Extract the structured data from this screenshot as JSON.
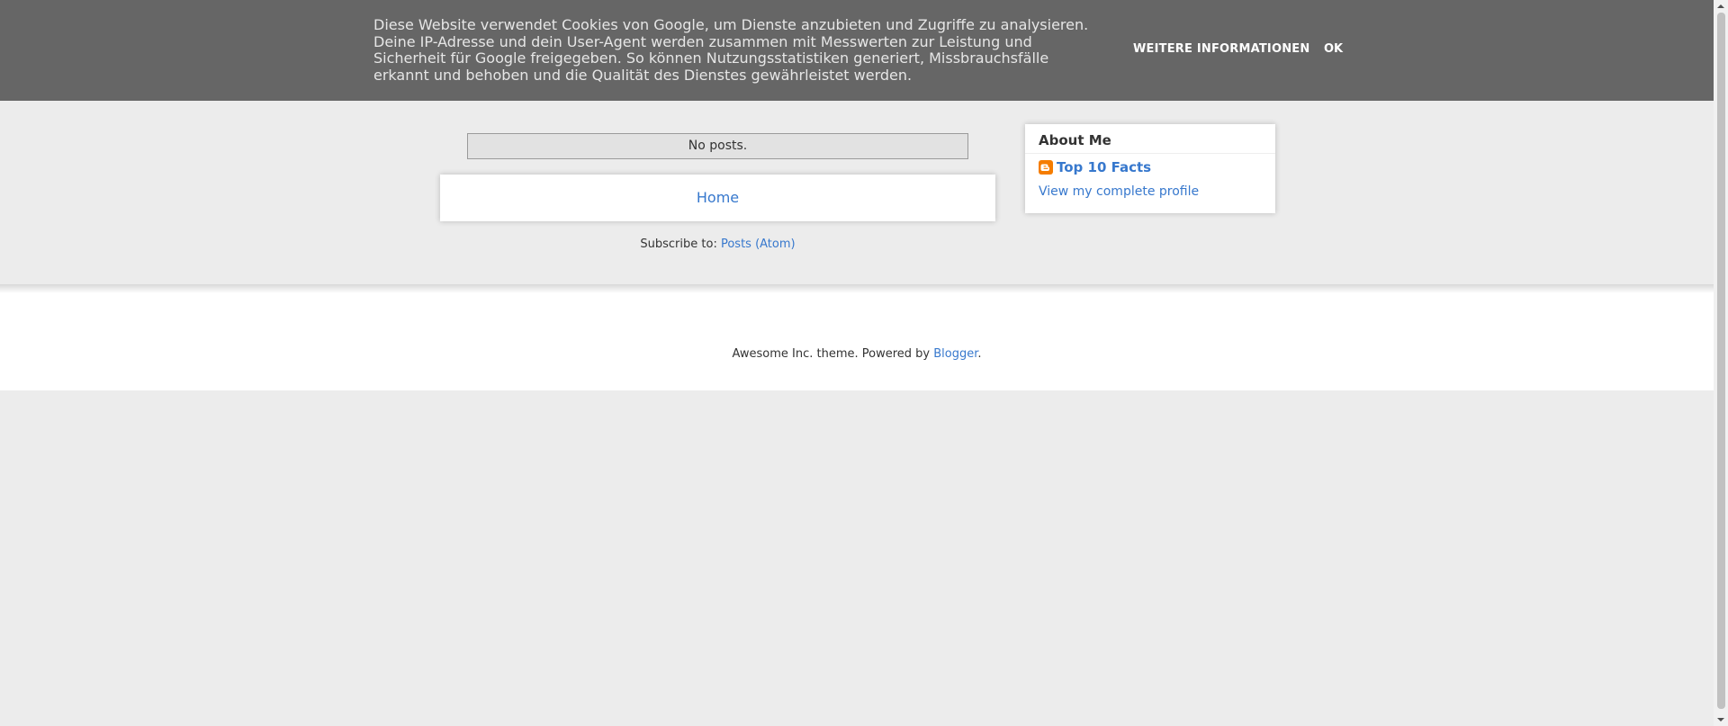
{
  "cookie_banner": {
    "text": "Diese Website verwendet Cookies von Google, um Dienste anzubieten und Zugriffe zu analysieren. Deine IP-Adresse und dein User-Agent werden zusammen mit Messwerten zur Leistung und Sicherheit für Google freigegeben. So können Nutzungsstatistiken generiert, Missbrauchsfälle erkannt und behoben und die Qualität des Dienstes gewährleistet werden.",
    "more_info_label": "WEITERE INFORMATIONEN",
    "ok_label": "OK"
  },
  "main": {
    "no_posts": "No posts.",
    "home_link": "Home",
    "subscribe_prefix": "Subscribe to: ",
    "subscribe_link": "Posts (Atom)"
  },
  "sidebar": {
    "about": {
      "title": "About Me",
      "profile_name": "Top 10 Facts",
      "profile_icon": "blogger-icon",
      "view_profile": "View my complete profile"
    }
  },
  "footer": {
    "attribution_prefix": "Awesome Inc. theme. Powered by ",
    "attribution_link": "Blogger",
    "attribution_suffix": "."
  },
  "colors": {
    "banner_bg": "#666666",
    "page_bg": "#ececec",
    "link": "#3778cd",
    "blogger_orange": "#f57d00"
  }
}
